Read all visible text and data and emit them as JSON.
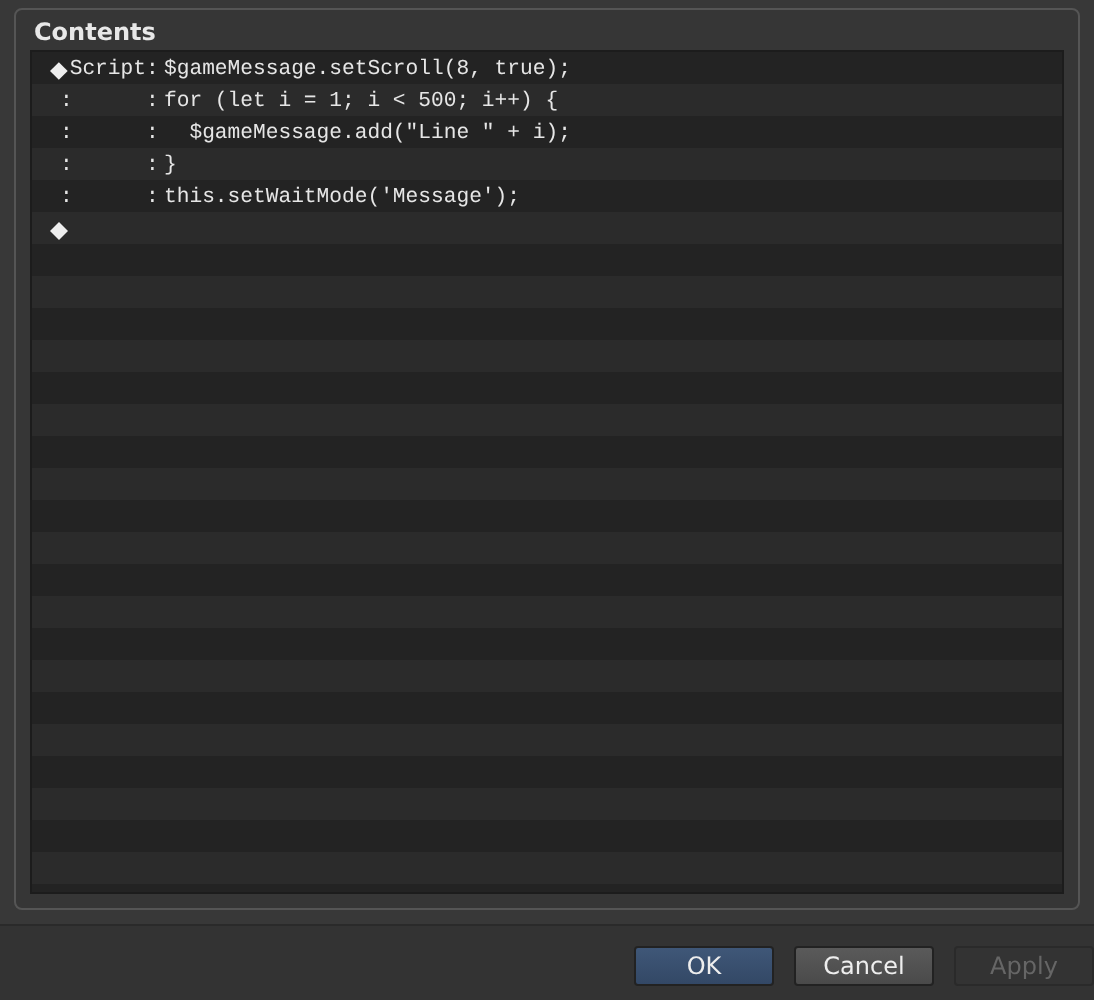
{
  "panel": {
    "title": "Contents"
  },
  "commands": [
    {
      "kind": "header",
      "label": "Script",
      "separator": ":",
      "code": "$gameMessage.setScroll(8, true);"
    },
    {
      "kind": "continuation",
      "marker": ":",
      "separator": ":",
      "code": "for (let i = 1; i < 500; i++) {"
    },
    {
      "kind": "continuation",
      "marker": ":",
      "separator": ":",
      "code": "  $gameMessage.add(\"Line \" + i);"
    },
    {
      "kind": "continuation",
      "marker": ":",
      "separator": ":",
      "code": "}"
    },
    {
      "kind": "continuation",
      "marker": ":",
      "separator": ":",
      "code": "this.setWaitMode('Message');"
    },
    {
      "kind": "end"
    }
  ],
  "buttons": [
    {
      "label": "OK",
      "kind": "primary",
      "disabled": false
    },
    {
      "label": "Cancel",
      "kind": "normal",
      "disabled": false
    },
    {
      "label": "Apply",
      "kind": "normal",
      "disabled": true
    }
  ]
}
